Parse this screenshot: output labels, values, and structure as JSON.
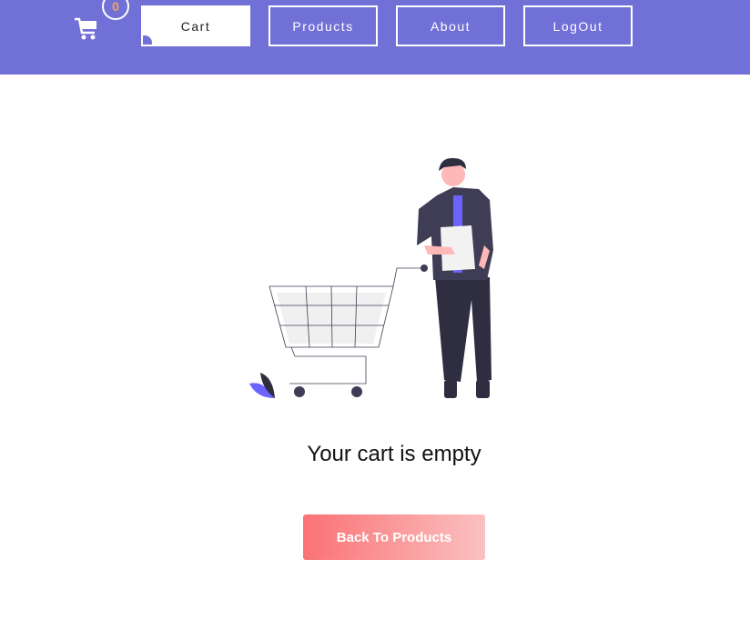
{
  "navbar": {
    "background": "#7170d6",
    "cart_icon": "shopping-cart-icon",
    "cart_count": "0",
    "items": [
      {
        "label": "Cart",
        "active": true
      },
      {
        "label": "Products",
        "active": false
      },
      {
        "label": "About",
        "active": false
      },
      {
        "label": "LogOut",
        "active": false
      }
    ]
  },
  "main": {
    "illustration": "empty-cart-illustration",
    "message": "Your cart is empty",
    "back_button_label": "Back To Products",
    "back_button_colors": [
      "#fa7275",
      "#fbc0c0"
    ]
  }
}
